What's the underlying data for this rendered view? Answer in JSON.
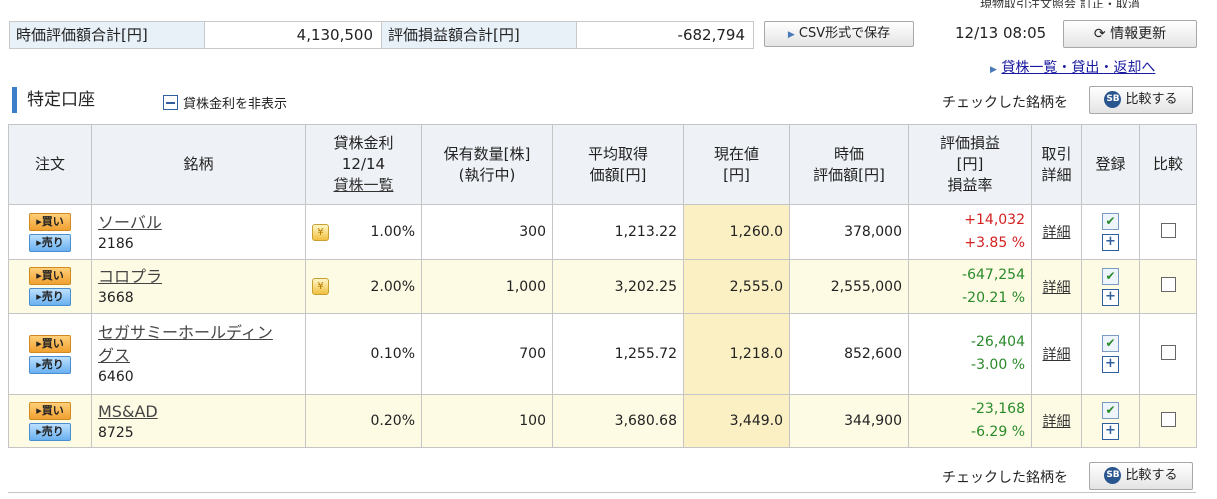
{
  "top_link": "現物取引注文照会 訂正・取消",
  "summary": {
    "market_value_label": "時価評価額合計[円]",
    "market_value": "4,130,500",
    "pl_label": "評価損益額合計[円]",
    "pl_value": "-682,794",
    "csv_label": "CSV形式で保存",
    "timestamp": "12/13 08:05",
    "refresh_label": "情報更新"
  },
  "lend_link": "貸株一覧・貸出・返却へ",
  "section": {
    "title": "特定口座",
    "toggle_label": "貸株金利を非表示",
    "compare_text": "チェックした銘柄を",
    "compare_button": "比較する",
    "compare_icon": "sbi-icon"
  },
  "table": {
    "headers": {
      "order": "注文",
      "name": "銘柄",
      "rate_l1": "貸株金利",
      "rate_l2": "12/14",
      "rate_l3": "貸株一覧",
      "qty_l1": "保有数量[株]",
      "qty_l2": "(執行中)",
      "avg_l1": "平均取得",
      "avg_l2": "価額[円]",
      "cur_l1": "現在値",
      "cur_l2": "[円]",
      "mv_l1": "時価",
      "mv_l2": "評価額[円]",
      "pl_l1": "評価損益",
      "pl_l2": "[円]",
      "pl_l3": "損益率",
      "detail_l1": "取引",
      "detail_l2": "詳細",
      "register": "登録",
      "compare": "比較"
    },
    "buy_label": "買い",
    "sell_label": "売り",
    "detail_label": "詳細",
    "rows": [
      {
        "name": "ソーバル",
        "code": "2186",
        "rate": "1.00%",
        "qty": "300",
        "avg": "1,213.22",
        "price": "1,260.0",
        "mv": "378,000",
        "pl": "+14,032",
        "plr": "+3.85 %"
      },
      {
        "name": "コロプラ",
        "code": "3668",
        "rate": "2.00%",
        "qty": "1,000",
        "avg": "3,202.25",
        "price": "2,555.0",
        "mv": "2,555,000",
        "pl": "-647,254",
        "plr": "-20.21 %"
      },
      {
        "name_l1": "セガサミーホールディン",
        "name_l2": "グス",
        "code": "6460",
        "rate": "0.10%",
        "qty": "700",
        "avg": "1,255.72",
        "price": "1,218.0",
        "mv": "852,600",
        "pl": "-26,404",
        "plr": "-3.00 %"
      },
      {
        "name": "MS&AD",
        "code": "8725",
        "rate": "0.20%",
        "qty": "100",
        "avg": "3,680.68",
        "price": "3,449.0",
        "mv": "344,900",
        "pl": "-23,168",
        "plr": "-6.29 %"
      }
    ]
  },
  "colors": {
    "positive": "#d42020",
    "negative": "#2a8a2a",
    "accent": "#3a7fc8"
  }
}
